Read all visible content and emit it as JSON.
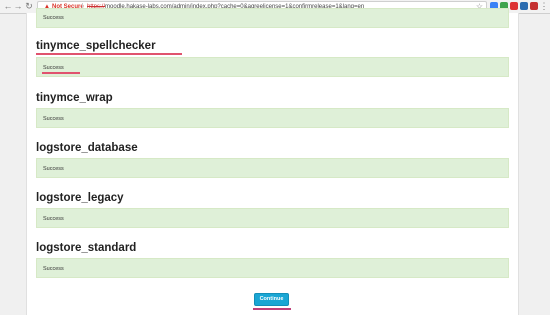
{
  "browser": {
    "security_label": "Not Secure",
    "url_scheme": "https://",
    "url_rest": "moodle.hakase-labs.com/admin/index.php?cache=0&agreelicense=1&confirmrelease=1&lang=en",
    "colors": {
      "warning": "#d93025"
    }
  },
  "page": {
    "top_status": "Success",
    "sections": [
      {
        "title": "tinymce_spellchecker",
        "status": "Success"
      },
      {
        "title": "tinymce_wrap",
        "status": "Success"
      },
      {
        "title": "logstore_database",
        "status": "Success"
      },
      {
        "title": "logstore_legacy",
        "status": "Success"
      },
      {
        "title": "logstore_standard",
        "status": "Success"
      }
    ],
    "continue_label": "Continue"
  }
}
